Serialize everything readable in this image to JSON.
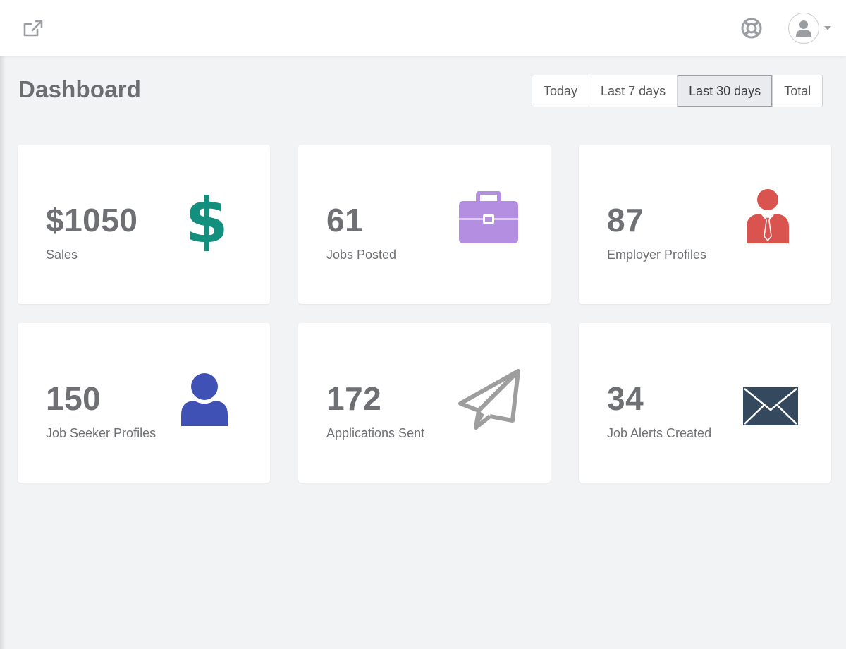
{
  "colors": {
    "sales_icon": "#138f7e",
    "jobs_icon": "#b48ee0",
    "employer_icon": "#d9534f",
    "seeker_icon": "#3f51b5",
    "applications_icon": "#9e9e9e",
    "alerts_icon": "#34495e"
  },
  "header": {
    "icons": [
      "external-link-icon",
      "life-ring-icon",
      "user-icon",
      "caret-down-icon"
    ]
  },
  "page": {
    "title": "Dashboard"
  },
  "range": {
    "options": [
      "Today",
      "Last 7 days",
      "Last 30 days",
      "Total"
    ],
    "selected": "Last 30 days"
  },
  "stats": [
    {
      "value": "$1050",
      "label": "Sales",
      "icon": "dollar-icon"
    },
    {
      "value": "61",
      "label": "Jobs Posted",
      "icon": "briefcase-icon"
    },
    {
      "value": "87",
      "label": "Employer Profiles",
      "icon": "employer-icon"
    },
    {
      "value": "150",
      "label": "Job Seeker Profiles",
      "icon": "user-icon"
    },
    {
      "value": "172",
      "label": "Applications Sent",
      "icon": "paper-plane-icon"
    },
    {
      "value": "34",
      "label": "Job Alerts Created",
      "icon": "envelope-icon"
    }
  ]
}
